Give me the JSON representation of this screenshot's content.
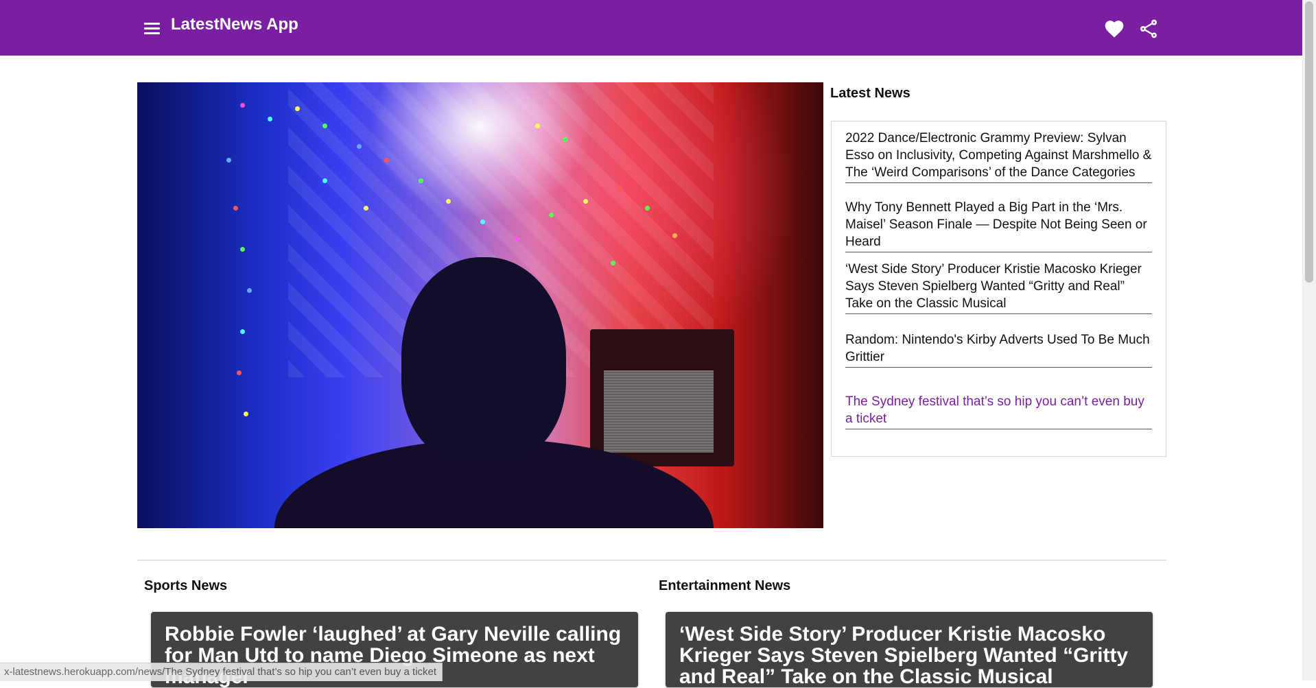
{
  "app": {
    "title": "LatestNews App",
    "menu_icon": "menu-icon",
    "favorite_icon": "heart-icon",
    "share_icon": "share-icon",
    "accent_color": "#7b1fa2"
  },
  "latest": {
    "heading": "Latest News",
    "items": [
      {
        "title": "2022 Dance/Electronic Grammy Preview: Sylvan Esso on Inclusivity, Competing Against Marshmello & The ‘Weird Comparisons’ of the Dance Categories"
      },
      {
        "title": "Why Tony Bennett Played a Big Part in the ‘Mrs. Maisel’ Season Finale — Despite Not Being Seen or Heard"
      },
      {
        "title": "‘West Side Story’ Producer Kristie Macosko Krieger Says Steven Spielberg Wanted “Gritty and Real” Take on the Classic Musical"
      },
      {
        "title": "Random: Nintendo's Kirby Adverts Used To Be Much Grittier"
      },
      {
        "title": "The Sydney festival that’s so hip you can’t even buy a ticket"
      }
    ]
  },
  "sports": {
    "heading": "Sports News",
    "card_title": "Robbie Fowler ‘laughed’ at Gary Neville calling for Man Utd to name Diego Simeone as next manager"
  },
  "entertainment": {
    "heading": "Entertainment News",
    "card_title": "‘West Side Story’ Producer Kristie Macosko Krieger Says Steven Spielberg Wanted “Gritty and Real” Take on the Classic Musical"
  },
  "status_bar": {
    "url": "x-latestnews.herokuapp.com/news/The Sydney festival that’s so hip you can’t even buy a ticket"
  }
}
